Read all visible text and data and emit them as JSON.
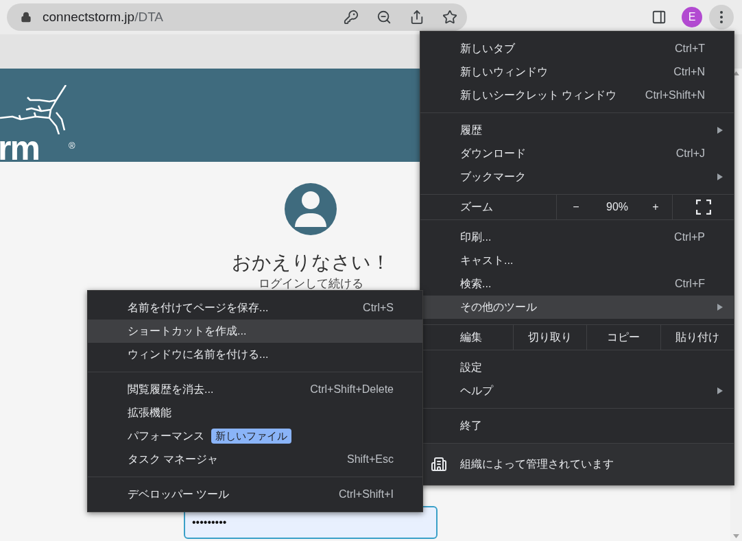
{
  "address_bar": {
    "host": "connectstorm.jp",
    "path": "/DTA"
  },
  "profile": {
    "letter": "E"
  },
  "page": {
    "logo_text": "rm",
    "logo_mark": "®",
    "heading": "おかえりなさい！",
    "subheading": "ログインして続ける",
    "password_value": "•••••••••"
  },
  "main_menu": {
    "groups": [
      {
        "kind": "list",
        "items": [
          {
            "label": "新しいタブ",
            "shortcut": "Ctrl+T",
            "submenu": false,
            "selected": false
          },
          {
            "label": "新しいウィンドウ",
            "shortcut": "Ctrl+N",
            "submenu": false,
            "selected": false
          },
          {
            "label": "新しいシークレット ウィンドウ",
            "shortcut": "Ctrl+Shift+N",
            "submenu": false,
            "selected": false
          }
        ]
      },
      {
        "kind": "list",
        "items": [
          {
            "label": "履歴",
            "submenu": true,
            "selected": false
          },
          {
            "label": "ダウンロード",
            "shortcut": "Ctrl+J",
            "submenu": false,
            "selected": false
          },
          {
            "label": "ブックマーク",
            "submenu": true,
            "selected": false
          }
        ]
      },
      {
        "kind": "zoom",
        "label": "ズーム",
        "minus": "−",
        "value": "90%",
        "plus": "+"
      },
      {
        "kind": "list",
        "items": [
          {
            "label": "印刷...",
            "shortcut": "Ctrl+P",
            "submenu": false,
            "selected": false
          },
          {
            "label": "キャスト...",
            "submenu": false,
            "selected": false
          },
          {
            "label": "検索...",
            "shortcut": "Ctrl+F",
            "submenu": false,
            "selected": false
          },
          {
            "label": "その他のツール",
            "submenu": true,
            "selected": true
          }
        ]
      },
      {
        "kind": "edit",
        "label": "編集",
        "actions": [
          "切り取り",
          "コピー",
          "貼り付け"
        ]
      },
      {
        "kind": "list",
        "items": [
          {
            "label": "設定",
            "submenu": false,
            "selected": false
          },
          {
            "label": "ヘルプ",
            "submenu": true,
            "selected": false
          }
        ]
      },
      {
        "kind": "list",
        "items": [
          {
            "label": "終了",
            "submenu": false,
            "selected": false
          }
        ]
      },
      {
        "kind": "managed",
        "label": "組織によって管理されています"
      }
    ]
  },
  "sub_menu": {
    "groups": [
      [
        {
          "label": "名前を付けてページを保存...",
          "shortcut": "Ctrl+S",
          "selected": false
        },
        {
          "label": "ショートカットを作成...",
          "selected": true
        },
        {
          "label": "ウィンドウに名前を付ける...",
          "selected": false
        }
      ],
      [
        {
          "label": "閲覧履歴を消去...",
          "shortcut": "Ctrl+Shift+Delete",
          "selected": false
        },
        {
          "label": "拡張機能",
          "selected": false
        },
        {
          "label": "パフォーマンス",
          "badge": "新しいファイル",
          "selected": false
        },
        {
          "label": "タスク マネージャ",
          "shortcut": "Shift+Esc",
          "selected": false
        }
      ],
      [
        {
          "label": "デベロッパー ツール",
          "shortcut": "Ctrl+Shift+I",
          "selected": false
        }
      ]
    ]
  }
}
